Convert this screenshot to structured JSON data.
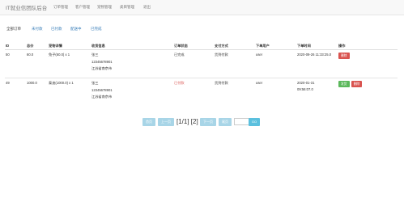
{
  "navbar": {
    "brand": "IT就业信团队后台",
    "items": [
      "订单管理",
      "客户管理",
      "宠物管理",
      "类目管理",
      "退出"
    ]
  },
  "filters": [
    "全部订单",
    "未付款",
    "已付款",
    "配送中",
    "已完成"
  ],
  "table": {
    "headers": [
      "ID",
      "总价",
      "宠物详情",
      "收货信息",
      "订单状态",
      "支付方式",
      "下单用户",
      "下单时间",
      "操作"
    ],
    "rows": [
      {
        "id": "50",
        "total": "60.0",
        "detail": "兔子(60.0) x 1",
        "address": [
          "张三",
          "12345678901",
          "江苏省南京市"
        ],
        "status": "已完成",
        "payment": "货到付款",
        "user": "user",
        "time": [
          "2020-09-26 11:33:25.0"
        ],
        "actions": [
          "删除"
        ]
      },
      {
        "id": "49",
        "total": "1000.0",
        "detail": "泰迪(1000.0) x 1",
        "address": [
          "张三",
          "12345678901",
          "江苏省南京市"
        ],
        "status": "已付款",
        "payment": "货到付款",
        "user": "user",
        "time": [
          "2020-01-31",
          "09:56:07.0"
        ],
        "actions": [
          "发货",
          "删除"
        ]
      }
    ]
  },
  "pagination": {
    "first": "首页",
    "prev": "上一页",
    "info": "[1/1] [2]",
    "next": "下一页",
    "last": "尾页",
    "go": "GO",
    "page_input_value": ""
  },
  "colors": {
    "link": "#337ab7",
    "danger": "#d9534f",
    "success": "#5cb85c",
    "pager": "#a8d5e7",
    "go": "#5bc0de"
  }
}
